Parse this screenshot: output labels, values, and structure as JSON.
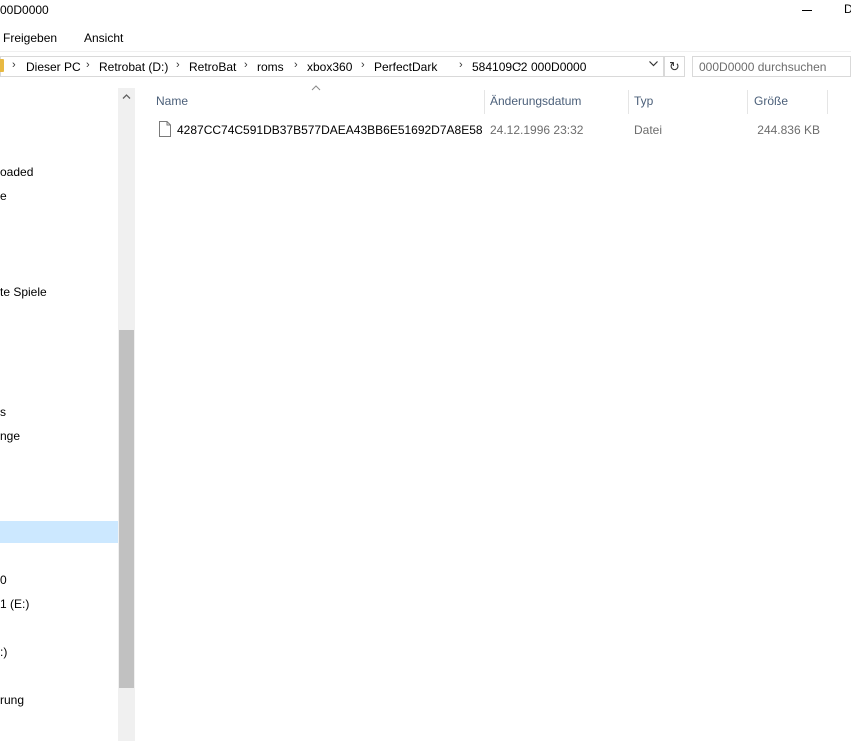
{
  "window": {
    "title": "00D0000",
    "restore_glyph": "D"
  },
  "ribbon": {
    "tabs": [
      "Freigeben",
      "Ansicht"
    ]
  },
  "address": {
    "crumbs": [
      "Dieser PC",
      "Retrobat (D:)",
      "RetroBat",
      "roms",
      "xbox360",
      "PerfectDark",
      "584109C2",
      "000D0000"
    ]
  },
  "search": {
    "placeholder": "000D0000 durchsuchen"
  },
  "nav": {
    "items": [
      "oaded",
      "e",
      "te Spiele",
      "s",
      "nge",
      "",
      "0",
      "1 (E:)",
      ":)",
      "rung"
    ]
  },
  "columns": {
    "name": "Name",
    "date": "Änderungsdatum",
    "type": "Typ",
    "size": "Größe"
  },
  "files": [
    {
      "name": "4287CC74C591DB37B577DAEA43BB6E51692D7A8E58",
      "date": "24.12.1996 23:32",
      "type": "Datei",
      "size": "244.836 KB"
    }
  ],
  "colors": {
    "selection": "#cce8ff",
    "header_text": "#4c607a",
    "folder": "#e8b942"
  },
  "icons": {
    "file": "document-icon",
    "folder": "folder-icon",
    "refresh": "refresh-icon"
  }
}
